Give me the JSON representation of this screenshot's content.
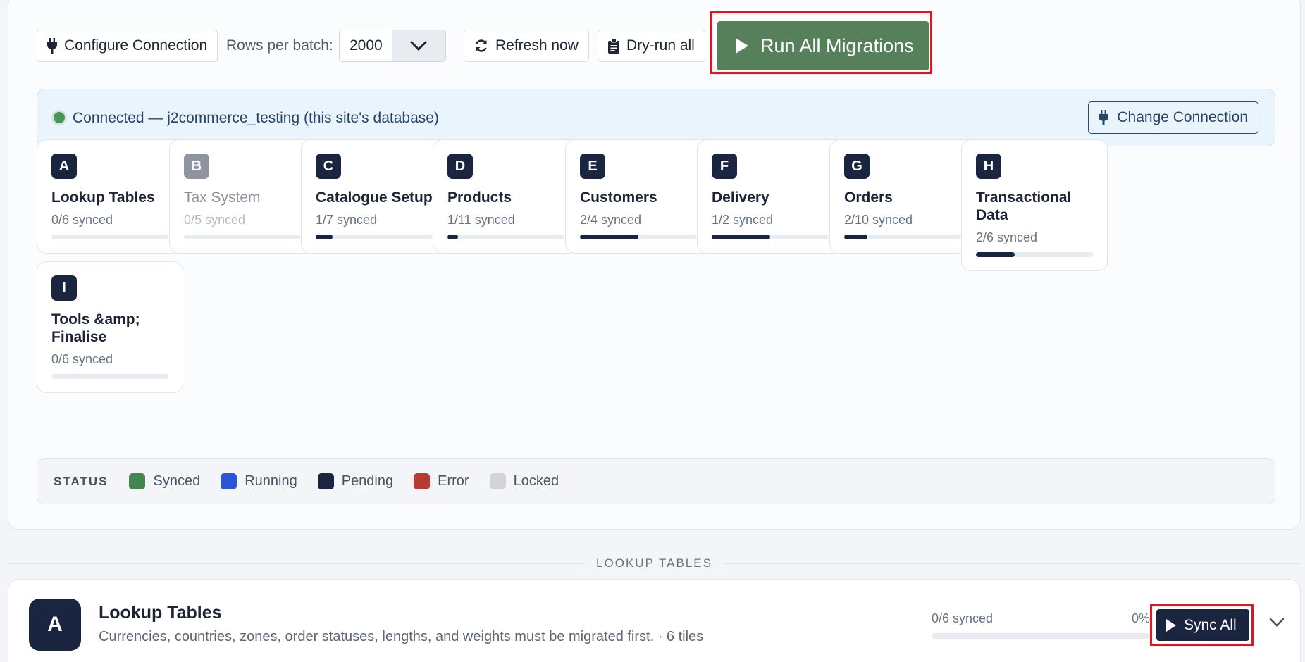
{
  "toolbar": {
    "configure_label": "Configure Connection",
    "rows_label": "Rows per batch:",
    "rows_value": "2000",
    "refresh_label": "Refresh now",
    "dryrun_label": "Dry-run all",
    "run_all_label": "Run All Migrations",
    "run_all_color": "#56805a"
  },
  "connection": {
    "status_text": "Connected — j2commerce_testing (this site's database)",
    "change_label": "Change Connection",
    "dot_color": "#47975a"
  },
  "tiles": [
    {
      "letter": "A",
      "name": "Lookup Tables",
      "count": "0/6 synced",
      "progress": 0
    },
    {
      "letter": "B",
      "name": "Tax System",
      "count": "0/5 synced",
      "progress": 0,
      "state": "locked"
    },
    {
      "letter": "C",
      "name": "Catalogue Setup",
      "count": "1/7 synced",
      "progress": 0.143
    },
    {
      "letter": "D",
      "name": "Products",
      "count": "1/11 synced",
      "progress": 0.091
    },
    {
      "letter": "E",
      "name": "Customers",
      "count": "2/4 synced",
      "progress": 0.5
    },
    {
      "letter": "F",
      "name": "Delivery",
      "count": "1/2 synced",
      "progress": 0.5
    },
    {
      "letter": "G",
      "name": "Orders",
      "count": "2/10 synced",
      "progress": 0.2
    },
    {
      "letter": "H",
      "name": "Transactional Data",
      "count": "2/6 synced",
      "progress": 0.333
    },
    {
      "letter": "I",
      "name": "Tools &amp; Finalise",
      "count": "0/6 synced",
      "progress": 0
    }
  ],
  "status_legend": {
    "title": "STATUS",
    "items": [
      {
        "label": "Synced",
        "color": "#41874f"
      },
      {
        "label": "Running",
        "color": "#2a55d4"
      },
      {
        "label": "Pending",
        "color": "#1a2540"
      },
      {
        "label": "Error",
        "color": "#b83a32"
      },
      {
        "label": "Locked",
        "color": "#d1d4d9"
      }
    ]
  },
  "section": {
    "divider_label": "LOOKUP TABLES",
    "letter": "A",
    "title": "Lookup Tables",
    "description": "Currencies, countries, zones, order statuses, lengths, and weights must be migrated first. · 6 tiles",
    "progress_label": "0/6 synced",
    "progress_pct": "0%",
    "progress": 0,
    "sync_label": "Sync All"
  },
  "icons": {
    "configure": "plug-icon",
    "rows_dropdown": "chevron-down-icon",
    "refresh": "refresh-icon",
    "dryrun": "clipboard-icon",
    "run_all": "play-icon",
    "change": "plug-icon",
    "sync": "play-icon",
    "section_toggle": "chevron-down-icon"
  }
}
